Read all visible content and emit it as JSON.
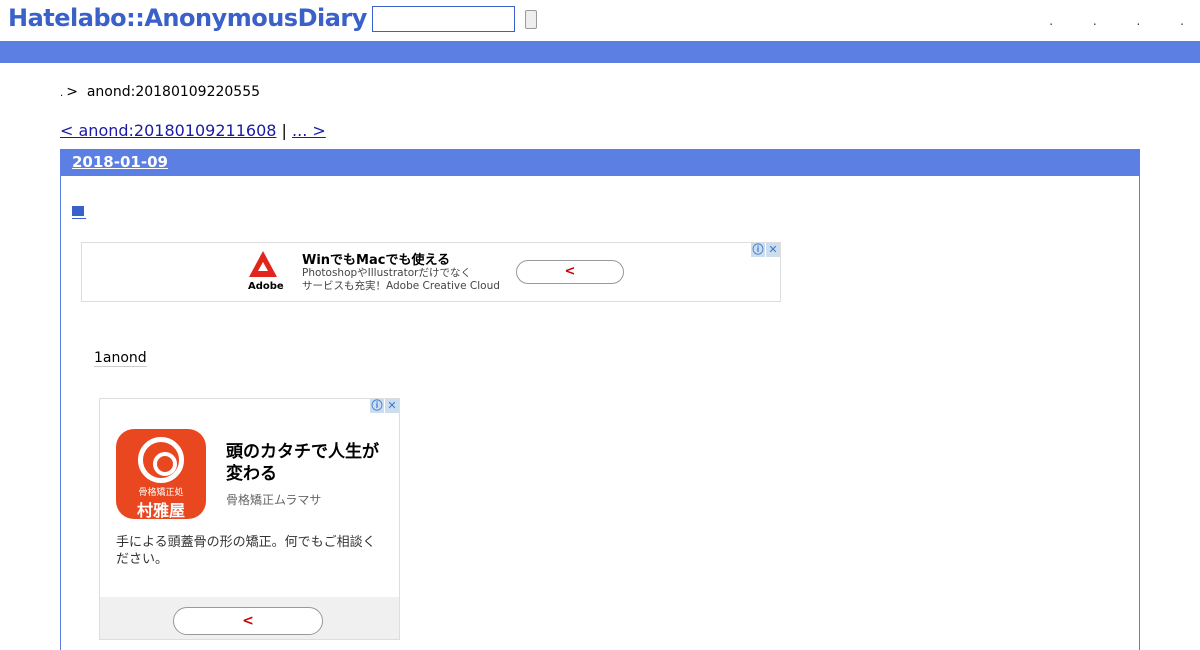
{
  "header": {
    "logo": "Hatelabo::AnonymousDiary",
    "search": {
      "value": "",
      "placeholder": ""
    },
    "links": [
      ".",
      ".",
      ".",
      "."
    ]
  },
  "breadcrumb": {
    "dot": ".",
    "separator": ">",
    "current": "anond:20180109220555"
  },
  "pager": {
    "prev": "< anond:20180109211608",
    "separator": "|",
    "next": "... > "
  },
  "section": {
    "date": "2018-01-09",
    "entry_text": "1anond"
  },
  "ad1": {
    "brand": "Adobe",
    "title": "WinでもMacでも使える",
    "line1": "PhotoshopやIllustratorだけでなく",
    "line2": "サービスも充実！Adobe Creative Cloud",
    "button": "<",
    "info_icon": "ⓘ",
    "close_icon": "✕"
  },
  "ad2": {
    "icon_sub": "骨格矯正処",
    "icon_name": "村雅屋",
    "title": "頭のカタチで人生が変わる",
    "brand": "骨格矯正ムラマサ",
    "body": "手による頭蓋骨の形の矯正。何でもご相談ください。",
    "button": "<",
    "info_icon": "ⓘ",
    "close_icon": "✕"
  },
  "colors": {
    "accent": "#5b7fe3",
    "logo": "#3a60c9",
    "link": "#1a1aa6"
  }
}
